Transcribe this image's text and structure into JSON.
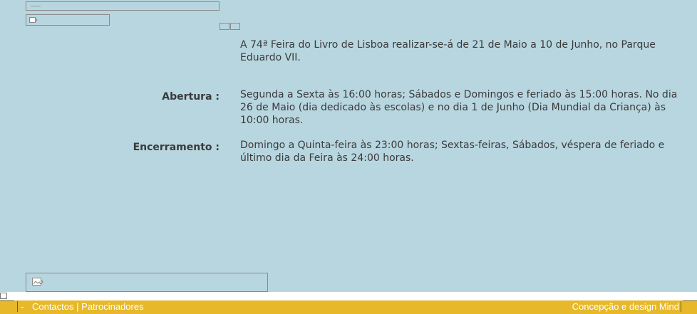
{
  "content": {
    "intro": "A 74ª Feira do Livro de Lisboa realizar-se-á de 21 de Maio a 10 de Junho, no Parque Eduardo VII.",
    "opening": {
      "label": "Abertura :",
      "text": "Segunda a Sexta às 16:00 horas; Sábados e Domingos e feriado às 15:00 horas. No dia 26 de Maio (dia dedicado às escolas) e no dia 1 de Junho (Dia Mundial da Criança) às 10:00 horas."
    },
    "closing": {
      "label": "Encerramento :",
      "text": "Domingo a Quinta-feira às 23:00 horas; Sextas-feiras, Sábados, véspera de feriado e último dia da Feira às 24:00 horas."
    }
  },
  "footer": {
    "bullet": "-",
    "contacts_label": "Contactos",
    "separator": "|",
    "sponsors_label": "Patrocinadores",
    "credits": "Concepção e design Mind"
  },
  "colors": {
    "background": "#b8d6e0",
    "footer": "#e6b82a",
    "text": "#3a3a3a"
  },
  "icons": [
    "broken-image-icon"
  ]
}
